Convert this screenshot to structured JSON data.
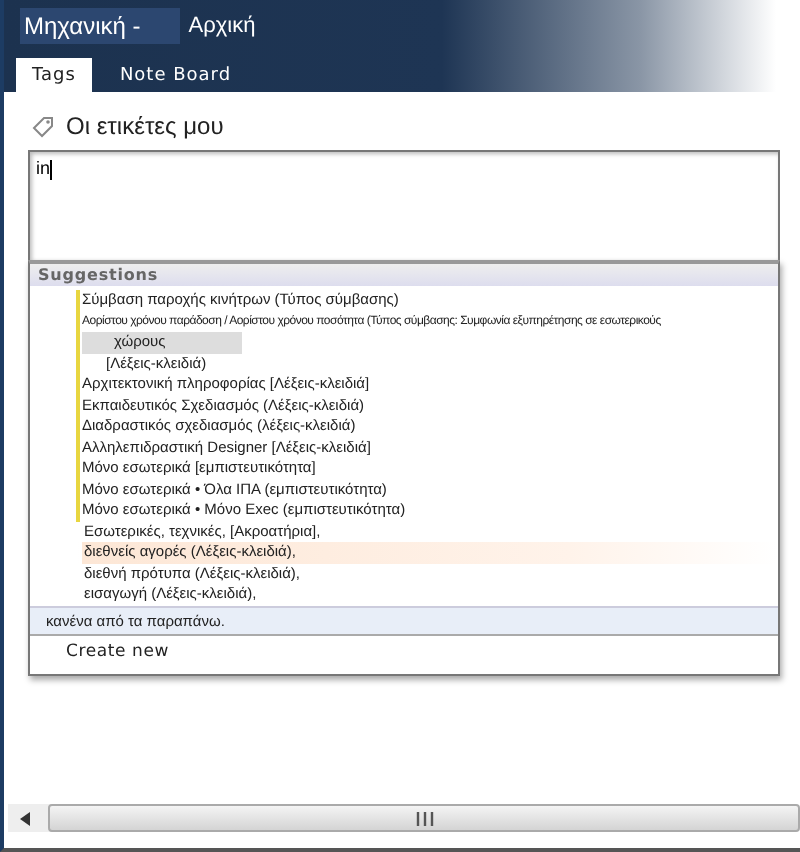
{
  "header": {
    "site_title": "Μηχανική -",
    "home_link": "Αρχική"
  },
  "tabs": [
    {
      "label": "Tags",
      "selected": true
    },
    {
      "label": "Note Board",
      "selected": false
    }
  ],
  "heading": "Οι ετικέτες μου",
  "tag_input": {
    "value": "in"
  },
  "suggestions": {
    "title": "Suggestions",
    "items": [
      {
        "lines": [
          "Σύμβαση παροχής κινήτρων (Τύπος σύμβασης)"
        ],
        "matched": true,
        "selected": false
      },
      {
        "lines": [
          "Αορίστου χρόνου παράδοση / Αορίστου χρόνου ποσότητα (Τύπος σύμβασης: Συμφωνία εξυπηρέτησης σε εσωτερικούς",
          "χώρους",
          "[Λέξεις-κλειδιά)"
        ],
        "matched": true,
        "selected": false
      },
      {
        "lines": [
          "Αρχιτεκτονική πληροφορίας [Λέξεις-κλειδιά]"
        ],
        "matched": true,
        "selected": false
      },
      {
        "lines": [
          "Εκπαιδευτικός Σχεδιασμός (Λέξεις-κλειδιά)"
        ],
        "matched": true,
        "selected": false
      },
      {
        "lines": [
          "Διαδραστικός σχεδιασμός (λέξεις-κλειδιά)"
        ],
        "matched": true,
        "selected": false
      },
      {
        "lines": [
          "Αλληλεπιδραστική Designer [Λέξεις-κλειδιά]"
        ],
        "matched": true,
        "selected": false
      },
      {
        "lines": [
          "Μόνο εσωτερικά [εμπιστευτικότητα]"
        ],
        "matched": true,
        "selected": false
      },
      {
        "lines": [
          "Μόνο εσωτερικά • Όλα ΙΠΑ (εμπιστευτικότητα)"
        ],
        "matched": true,
        "selected": false
      },
      {
        "lines": [
          "Μόνο εσωτερικά •  Μόνο Exec (εμπιστευτικότητα)"
        ],
        "matched": true,
        "selected": false
      },
      {
        "lines": [
          "Εσωτερικές, τεχνικές, [Ακροατήρια],"
        ],
        "matched": false,
        "selected": false
      },
      {
        "lines": [
          "διεθνείς αγορές (Λέξεις-κλειδιά),"
        ],
        "matched": false,
        "selected": true
      },
      {
        "lines": [
          "διεθνή πρότυπα (Λέξεις-κλειδιά),"
        ],
        "matched": false,
        "selected": false
      },
      {
        "lines": [
          "εισαγωγή (Λέξεις-κλειδιά),"
        ],
        "matched": false,
        "selected": false
      }
    ],
    "none_option": "κανένα από τα παραπάνω.",
    "create_new": "Create new"
  }
}
